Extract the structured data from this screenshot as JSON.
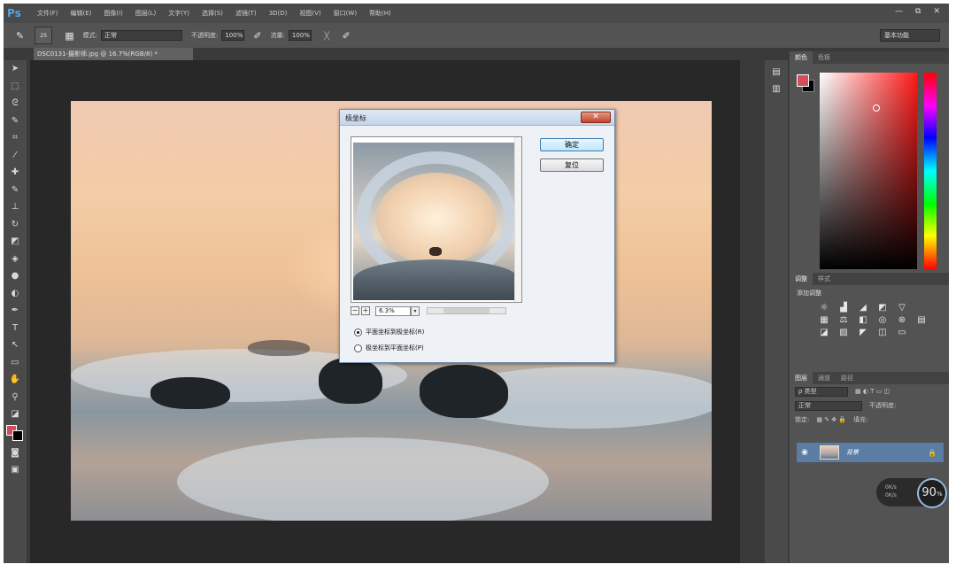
{
  "app": {
    "logo": "Ps"
  },
  "menu": [
    "文件(F)",
    "编辑(E)",
    "图像(I)",
    "图层(L)",
    "文字(Y)",
    "选择(S)",
    "滤镜(T)",
    "3D(D)",
    "视图(V)",
    "窗口(W)",
    "帮助(H)"
  ],
  "window_controls": [
    "—",
    "⧉",
    "✕"
  ],
  "options": {
    "brush_size": "25",
    "mode_label": "模式:",
    "mode_value": "正常",
    "opacity_label": "不透明度:",
    "opacity_value": "100%",
    "flow_label": "流量:",
    "flow_value": "100%",
    "workspace": "基本功能"
  },
  "document_tab": "DSC0131-摄影师.jpg @ 16.7%(RGB/8) *",
  "tools": [
    "move-icon",
    "marquee-icon",
    "lasso-icon",
    "quick-select-icon",
    "crop-icon",
    "eyedropper-icon",
    "healing-icon",
    "brush-icon",
    "stamp-icon",
    "history-brush-icon",
    "eraser-icon",
    "bucket-icon",
    "blur-icon",
    "dodge-icon",
    "pen-icon",
    "type-icon",
    "path-select-icon",
    "shape-icon",
    "hand-icon",
    "zoom-icon"
  ],
  "dialog": {
    "title": "极坐标",
    "close": "✕",
    "ok": "确定",
    "reset": "复位",
    "zoom_value": "6.3%",
    "radio_rect_to_polar": "平面坐标到极坐标(R)",
    "radio_polar_to_rect": "极坐标到平面坐标(P)"
  },
  "panels": {
    "color_tabs": [
      "颜色",
      "色板"
    ],
    "adjust_tabs": [
      "调整",
      "样式"
    ],
    "adjust_label": "添加调整",
    "layers_tabs": [
      "图层",
      "通道",
      "路径"
    ],
    "filter_kind": "ρ 类型",
    "blend_mode": "正常",
    "opacity_label": "不透明度:",
    "lock_label": "锁定:",
    "fill_label": "填充:",
    "layer_name": "背景"
  },
  "zoom_badge": {
    "value": "90",
    "unit": "%",
    "up": "0K/s",
    "down": "0K/s"
  },
  "colors": {
    "foreground": "#d14f5b",
    "background": "#000000",
    "accent": "#4fa4e8"
  }
}
